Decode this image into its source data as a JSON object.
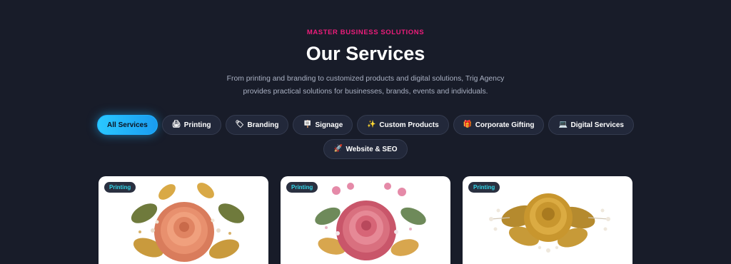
{
  "header": {
    "eyebrow": "MASTER BUSINESS SOLUTIONS",
    "title": "Our Services",
    "subtitle": "From printing and branding to customized products and digital solutions, Trig Agency provides practical solutions for businesses, brands, events and individuals."
  },
  "filters": [
    {
      "label": "All Services",
      "icon": "",
      "active": true
    },
    {
      "label": "Printing",
      "icon": "printer-icon"
    },
    {
      "label": "Branding",
      "icon": "tag-icon"
    },
    {
      "label": "Signage",
      "icon": "signpost-icon"
    },
    {
      "label": "Custom Products",
      "icon": "sparkles-icon"
    },
    {
      "label": "Corporate Gifting",
      "icon": "gift-icon"
    },
    {
      "label": "Digital Services",
      "icon": "laptop-icon"
    },
    {
      "label": "Website & SEO",
      "icon": "rocket-icon"
    }
  ],
  "cards": [
    {
      "badge": "Printing",
      "image": "peach-embroidered-rose"
    },
    {
      "badge": "Printing",
      "image": "pink-embroidered-rose"
    },
    {
      "badge": "Printing",
      "image": "gold-embroidered-rose"
    }
  ],
  "colors": {
    "background": "#181c29",
    "accent_pink": "#ec1c7a",
    "accent_cyan": "#2ac8ff",
    "badge_text": "#32d6e8"
  }
}
